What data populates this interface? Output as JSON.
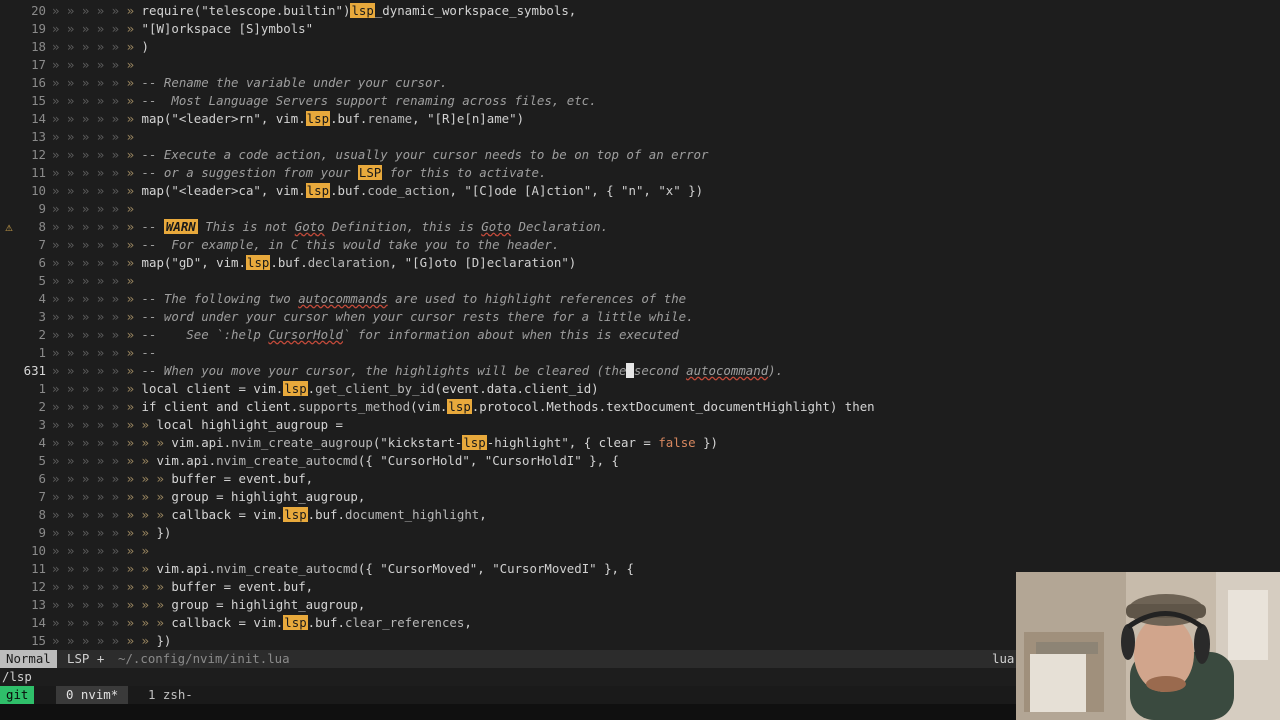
{
  "editor": {
    "warn_sign": "⚠",
    "lines": [
      {
        "num": "20",
        "sign": "",
        "cur": false,
        "segs": [
          [
            "» » » » » ",
            "g"
          ],
          [
            "» ",
            "b"
          ],
          [
            "require(",
            "k"
          ],
          [
            "\"telescope.builtin\"",
            "s"
          ],
          [
            ")",
            "k"
          ],
          [
            "lsp",
            "lsp"
          ],
          [
            "_dynamic_workspace_symbols,",
            "k"
          ]
        ]
      },
      {
        "num": "19",
        "sign": "",
        "cur": false,
        "segs": [
          [
            "» » » » » ",
            "g"
          ],
          [
            "» ",
            "b"
          ],
          [
            "\"[W]orkspace [S]ymbols\"",
            "s"
          ]
        ]
      },
      {
        "num": "18",
        "sign": "",
        "cur": false,
        "segs": [
          [
            "» » » » » ",
            "g"
          ],
          [
            "» ",
            "b"
          ],
          [
            ")",
            "k"
          ]
        ]
      },
      {
        "num": "17",
        "sign": "",
        "cur": false,
        "segs": [
          [
            "» » » » » ",
            "g"
          ],
          [
            "» ",
            "b"
          ]
        ]
      },
      {
        "num": "16",
        "sign": "",
        "cur": false,
        "segs": [
          [
            "» » » » » ",
            "g"
          ],
          [
            "» ",
            "b"
          ],
          [
            "-- Rename the variable under your cursor.",
            "c"
          ]
        ]
      },
      {
        "num": "15",
        "sign": "",
        "cur": false,
        "segs": [
          [
            "» » » » » ",
            "g"
          ],
          [
            "» ",
            "b"
          ],
          [
            "--  Most Language Servers support renaming across files, etc.",
            "c"
          ]
        ]
      },
      {
        "num": "14",
        "sign": "",
        "cur": false,
        "segs": [
          [
            "» » » » » ",
            "g"
          ],
          [
            "» ",
            "b"
          ],
          [
            "map(",
            "k"
          ],
          [
            "\"<leader>rn\"",
            "s"
          ],
          [
            ", vim.",
            "k"
          ],
          [
            "lsp",
            "lsp"
          ],
          [
            ".buf.",
            "k"
          ],
          [
            "rename",
            "m"
          ],
          [
            ", ",
            "k"
          ],
          [
            "\"[R]e[n]ame\"",
            "s"
          ],
          [
            ")",
            "k"
          ]
        ]
      },
      {
        "num": "13",
        "sign": "",
        "cur": false,
        "segs": [
          [
            "» » » » » ",
            "g"
          ],
          [
            "» ",
            "b"
          ]
        ]
      },
      {
        "num": "12",
        "sign": "",
        "cur": false,
        "segs": [
          [
            "» » » » » ",
            "g"
          ],
          [
            "» ",
            "b"
          ],
          [
            "-- Execute a code action, usually your cursor needs to be on top of an error",
            "c"
          ]
        ]
      },
      {
        "num": "11",
        "sign": "",
        "cur": false,
        "segs": [
          [
            "» » » » » ",
            "g"
          ],
          [
            "» ",
            "b"
          ],
          [
            "-- or a suggestion from your ",
            "c"
          ],
          [
            "LSP",
            "lsp"
          ],
          [
            " for this to activate.",
            "c"
          ]
        ]
      },
      {
        "num": "10",
        "sign": "",
        "cur": false,
        "segs": [
          [
            "» » » » » ",
            "g"
          ],
          [
            "» ",
            "b"
          ],
          [
            "map(",
            "k"
          ],
          [
            "\"<leader>ca\"",
            "s"
          ],
          [
            ", vim.",
            "k"
          ],
          [
            "lsp",
            "lsp"
          ],
          [
            ".buf.",
            "k"
          ],
          [
            "code_action",
            "m"
          ],
          [
            ", ",
            "k"
          ],
          [
            "\"[C]ode [A]ction\"",
            "s"
          ],
          [
            ", { ",
            "k"
          ],
          [
            "\"n\"",
            "s"
          ],
          [
            ", ",
            "k"
          ],
          [
            "\"x\"",
            "s"
          ],
          [
            " })",
            "k"
          ]
        ]
      },
      {
        "num": "9",
        "sign": "",
        "cur": false,
        "segs": [
          [
            "» » » » » ",
            "g"
          ],
          [
            "» ",
            "b"
          ]
        ]
      },
      {
        "num": "8",
        "sign": "warn",
        "cur": false,
        "segs": [
          [
            "» » » » » ",
            "g"
          ],
          [
            "» ",
            "b"
          ],
          [
            "-- ",
            "c"
          ],
          [
            "WARN",
            "warn"
          ],
          [
            " This is not ",
            "c"
          ],
          [
            "Goto",
            "u"
          ],
          [
            " Definition, this is ",
            "c"
          ],
          [
            "Goto",
            "u"
          ],
          [
            " Declaration.",
            "c"
          ]
        ]
      },
      {
        "num": "7",
        "sign": "",
        "cur": false,
        "segs": [
          [
            "» » » » » ",
            "g"
          ],
          [
            "» ",
            "b"
          ],
          [
            "--  For example, in C this would take you to the header.",
            "c"
          ]
        ]
      },
      {
        "num": "6",
        "sign": "",
        "cur": false,
        "segs": [
          [
            "» » » » » ",
            "g"
          ],
          [
            "» ",
            "b"
          ],
          [
            "map(",
            "k"
          ],
          [
            "\"gD\"",
            "s"
          ],
          [
            ", vim.",
            "k"
          ],
          [
            "lsp",
            "lsp"
          ],
          [
            ".buf.",
            "k"
          ],
          [
            "declaration",
            "m"
          ],
          [
            ", ",
            "k"
          ],
          [
            "\"[G]oto [D]eclaration\"",
            "s"
          ],
          [
            ")",
            "k"
          ]
        ]
      },
      {
        "num": "5",
        "sign": "",
        "cur": false,
        "segs": [
          [
            "» » » » » ",
            "g"
          ],
          [
            "» ",
            "b"
          ]
        ]
      },
      {
        "num": "4",
        "sign": "",
        "cur": false,
        "segs": [
          [
            "» » » » » ",
            "g"
          ],
          [
            "» ",
            "b"
          ],
          [
            "-- The following two ",
            "c"
          ],
          [
            "autocommands",
            "u"
          ],
          [
            " are used to highlight references of the",
            "c"
          ]
        ]
      },
      {
        "num": "3",
        "sign": "",
        "cur": false,
        "segs": [
          [
            "» » » » » ",
            "g"
          ],
          [
            "» ",
            "b"
          ],
          [
            "-- word under your cursor when your cursor rests there for a little while.",
            "c"
          ]
        ]
      },
      {
        "num": "2",
        "sign": "",
        "cur": false,
        "segs": [
          [
            "» » » » » ",
            "g"
          ],
          [
            "» ",
            "b"
          ],
          [
            "--    See `:help ",
            "c"
          ],
          [
            "CursorHold",
            "u"
          ],
          [
            "` for information about when this is executed",
            "c"
          ]
        ]
      },
      {
        "num": "1",
        "sign": "",
        "cur": false,
        "segs": [
          [
            "» » » » » ",
            "g"
          ],
          [
            "» ",
            "b"
          ],
          [
            "--",
            "c"
          ]
        ]
      },
      {
        "num": "631",
        "sign": "",
        "cur": true,
        "segs": [
          [
            "» » » » » ",
            "g"
          ],
          [
            "» ",
            "b"
          ],
          [
            "-- When you move your cursor, the highlights will be cleared (the",
            "c"
          ],
          [
            " ",
            "cursor"
          ],
          [
            "second ",
            "c"
          ],
          [
            "autocommand",
            "u"
          ],
          [
            ").",
            "c"
          ]
        ]
      },
      {
        "num": "1",
        "sign": "",
        "cur": false,
        "segs": [
          [
            "» » » » » ",
            "g"
          ],
          [
            "» ",
            "b"
          ],
          [
            "local client = vim.",
            "k"
          ],
          [
            "lsp",
            "lsp"
          ],
          [
            ".",
            "k"
          ],
          [
            "get_client_by_id",
            "m"
          ],
          [
            "(event.data.client_id)",
            "k"
          ]
        ]
      },
      {
        "num": "2",
        "sign": "",
        "cur": false,
        "segs": [
          [
            "» » » » » ",
            "g"
          ],
          [
            "» ",
            "b"
          ],
          [
            "if client and client.",
            "k"
          ],
          [
            "supports_method",
            "m"
          ],
          [
            "(vim.",
            "k"
          ],
          [
            "lsp",
            "lsp"
          ],
          [
            ".protocol.Methods.textDocument_documentHighlight) then",
            "k"
          ]
        ]
      },
      {
        "num": "3",
        "sign": "",
        "cur": false,
        "segs": [
          [
            "» » » » » ",
            "g"
          ],
          [
            "» ",
            "b"
          ],
          [
            "» ",
            "b"
          ],
          [
            "local highlight_augroup =",
            "k"
          ]
        ]
      },
      {
        "num": "4",
        "sign": "",
        "cur": false,
        "segs": [
          [
            "» » » » » ",
            "g"
          ],
          [
            "» ",
            "b"
          ],
          [
            "» » ",
            "b"
          ],
          [
            "vim.api.",
            "k"
          ],
          [
            "nvim_create_augroup",
            "m"
          ],
          [
            "(",
            "k"
          ],
          [
            "\"kickstart-",
            "s"
          ],
          [
            "lsp",
            "lsp"
          ],
          [
            "-highlight\"",
            "s"
          ],
          [
            ", { clear = ",
            "k"
          ],
          [
            "false",
            "fb"
          ],
          [
            " })",
            "k"
          ]
        ]
      },
      {
        "num": "5",
        "sign": "",
        "cur": false,
        "segs": [
          [
            "» » » » » ",
            "g"
          ],
          [
            "» ",
            "b"
          ],
          [
            "» ",
            "b"
          ],
          [
            "vim.api.",
            "k"
          ],
          [
            "nvim_create_autocmd",
            "m"
          ],
          [
            "({ ",
            "k"
          ],
          [
            "\"CursorHold\"",
            "s"
          ],
          [
            ", ",
            "k"
          ],
          [
            "\"CursorHoldI\"",
            "s"
          ],
          [
            " }, {",
            "k"
          ]
        ]
      },
      {
        "num": "6",
        "sign": "",
        "cur": false,
        "segs": [
          [
            "» » » » » ",
            "g"
          ],
          [
            "» ",
            "b"
          ],
          [
            "» » ",
            "b"
          ],
          [
            "buffer = event.buf,",
            "k"
          ]
        ]
      },
      {
        "num": "7",
        "sign": "",
        "cur": false,
        "segs": [
          [
            "» » » » » ",
            "g"
          ],
          [
            "» ",
            "b"
          ],
          [
            "» » ",
            "b"
          ],
          [
            "group = highlight_augroup,",
            "k"
          ]
        ]
      },
      {
        "num": "8",
        "sign": "",
        "cur": false,
        "segs": [
          [
            "» » » » » ",
            "g"
          ],
          [
            "» ",
            "b"
          ],
          [
            "» » ",
            "b"
          ],
          [
            "callback = vim.",
            "k"
          ],
          [
            "lsp",
            "lsp"
          ],
          [
            ".buf.",
            "k"
          ],
          [
            "document_highlight",
            "m"
          ],
          [
            ",",
            "k"
          ]
        ]
      },
      {
        "num": "9",
        "sign": "",
        "cur": false,
        "segs": [
          [
            "» » » » » ",
            "g"
          ],
          [
            "» ",
            "b"
          ],
          [
            "» ",
            "b"
          ],
          [
            "})",
            "k"
          ]
        ]
      },
      {
        "num": "10",
        "sign": "",
        "cur": false,
        "segs": [
          [
            "» » » » » ",
            "g"
          ],
          [
            "» ",
            "b"
          ],
          [
            "» ",
            "b"
          ]
        ]
      },
      {
        "num": "11",
        "sign": "",
        "cur": false,
        "segs": [
          [
            "» » » » » ",
            "g"
          ],
          [
            "» ",
            "b"
          ],
          [
            "» ",
            "b"
          ],
          [
            "vim.api.",
            "k"
          ],
          [
            "nvim_create_autocmd",
            "m"
          ],
          [
            "({ ",
            "k"
          ],
          [
            "\"CursorMoved\"",
            "s"
          ],
          [
            ", ",
            "k"
          ],
          [
            "\"CursorMovedI\"",
            "s"
          ],
          [
            " }, {",
            "k"
          ]
        ]
      },
      {
        "num": "12",
        "sign": "",
        "cur": false,
        "segs": [
          [
            "» » » » » ",
            "g"
          ],
          [
            "» ",
            "b"
          ],
          [
            "» » ",
            "b"
          ],
          [
            "buffer = event.buf,",
            "k"
          ]
        ]
      },
      {
        "num": "13",
        "sign": "",
        "cur": false,
        "segs": [
          [
            "» » » » » ",
            "g"
          ],
          [
            "» ",
            "b"
          ],
          [
            "» » ",
            "b"
          ],
          [
            "group = highlight_augroup,",
            "k"
          ]
        ]
      },
      {
        "num": "14",
        "sign": "",
        "cur": false,
        "segs": [
          [
            "» » » » » ",
            "g"
          ],
          [
            "» ",
            "b"
          ],
          [
            "» » ",
            "b"
          ],
          [
            "callback = vim.",
            "k"
          ],
          [
            "lsp",
            "lsp"
          ],
          [
            ".buf.",
            "k"
          ],
          [
            "clear_references",
            "m"
          ],
          [
            ",",
            "k"
          ]
        ]
      },
      {
        "num": "15",
        "sign": "",
        "cur": false,
        "segs": [
          [
            "» » » » » ",
            "g"
          ],
          [
            "» ",
            "b"
          ],
          [
            "» ",
            "b"
          ],
          [
            "})",
            "k"
          ]
        ]
      }
    ]
  },
  "statusline": {
    "mode": "Normal",
    "branch": "LSP +",
    "filepath": "~/.config/nvim/init.lua",
    "filetype": "lua"
  },
  "cmdline": "/lsp",
  "tmux": {
    "session": "git",
    "windows": [
      {
        "label": "0 nvim*"
      },
      {
        "label": "1 zsh-"
      }
    ]
  },
  "colors": {
    "background": "#1d1d1d",
    "highlight": "#e8a93c",
    "tmux_session": "#2fbf6a"
  }
}
